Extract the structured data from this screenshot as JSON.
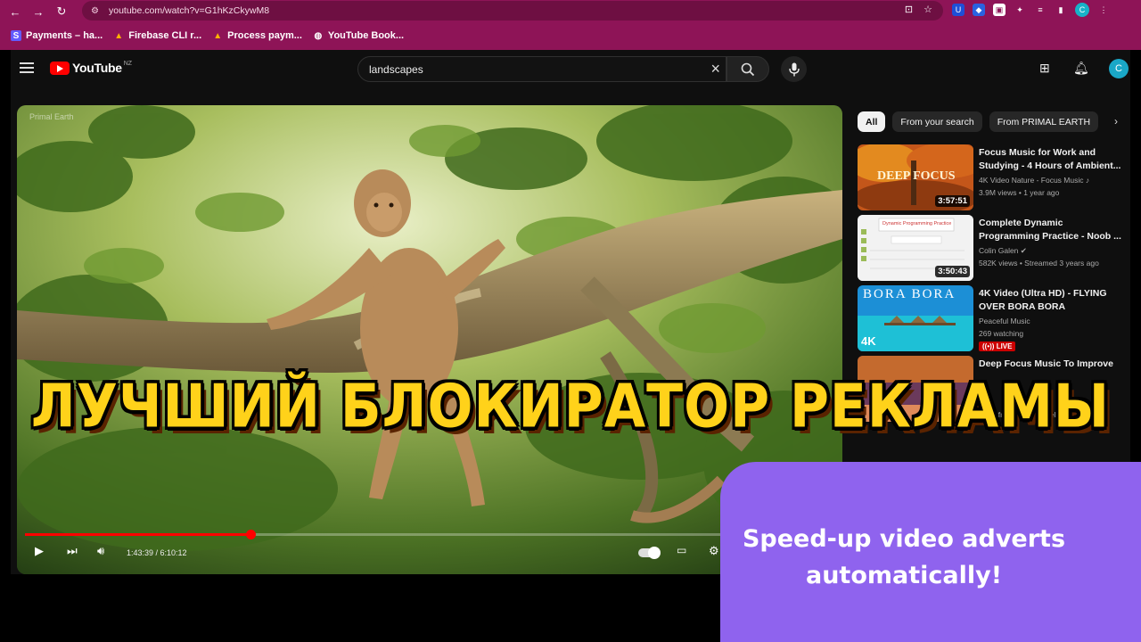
{
  "browser": {
    "url": "youtube.com/watch?v=G1hKzCkywM8",
    "profile_initial": "C",
    "bookmarks": [
      {
        "label": "Payments – ha...",
        "icon": "stripe-icon"
      },
      {
        "label": "Firebase CLI r...",
        "icon": "firebase-icon"
      },
      {
        "label": "Process paym...",
        "icon": "firebase-icon"
      },
      {
        "label": "YouTube Book...",
        "icon": "globe-icon"
      }
    ]
  },
  "youtube": {
    "logo_text": "YouTube",
    "region": "NZ",
    "search_value": "landscapes",
    "avatar_initial": "C"
  },
  "player": {
    "watermark": "Primal Earth",
    "time": "1:43:39 / 6:10:12",
    "progress": 0.28
  },
  "chips": [
    "All",
    "From your search",
    "From PRIMAL EARTH"
  ],
  "recommendations": [
    {
      "title": "Focus Music for Work and Studying - 4 Hours of Ambient...",
      "channel": "4K Video Nature - Focus Music",
      "stats": "3.9M views • 1 year ago",
      "duration": "3:57:51",
      "thumb_text": "DEEP FOCUS"
    },
    {
      "title": "Complete Dynamic Programming Practice - Noob ...",
      "channel": "Colin Galen",
      "stats": "582K views • Streamed 3 years ago",
      "duration": "3:50:43",
      "thumb_text": "Dynamic Programming Practice"
    },
    {
      "title": "4K Video (Ultra HD) - FLYING OVER BORA BORA Unbelievabl...",
      "channel": "Peaceful Music",
      "stats": "269 watching",
      "live": "LIVE",
      "thumb_text": "BORA BORA",
      "thumb_badge": "4K"
    },
    {
      "title": "Deep Focus Music To Improve",
      "stats": "More from this channel for you"
    }
  ],
  "overlay": {
    "banner": "ЛУЧШИЙ БЛОКИРАТОР РЕКЛАМЫ",
    "promo_line1": "Speed-up video adverts",
    "promo_line2": "automatically!"
  },
  "colors": {
    "chrome": "#8e1457",
    "yt_red": "#ff0000",
    "banner_yellow": "#ffd21a",
    "promo_purple": "#8f63ee"
  }
}
